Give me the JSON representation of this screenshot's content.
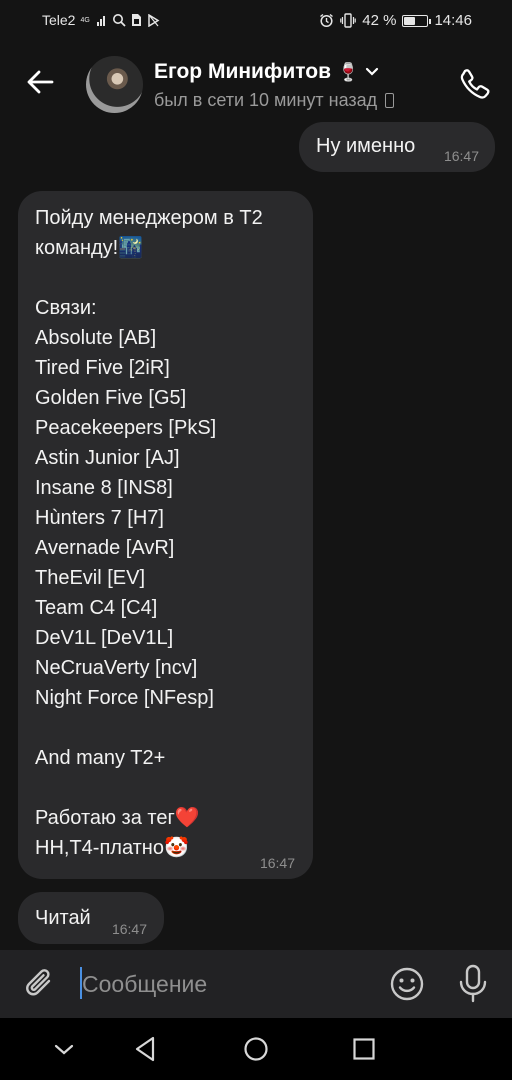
{
  "status_bar": {
    "carrier": "Tele2",
    "network": "4G",
    "battery_percent": "42 %",
    "battery_level": 0.42,
    "time": "14:46"
  },
  "header": {
    "contact_name": "Егор Минифитов",
    "name_emoji": "🍷",
    "last_seen": "был в сети 10 минут назад"
  },
  "messages": [
    {
      "direction": "outgoing",
      "text": "Ну именно",
      "time": "16:47"
    },
    {
      "direction": "incoming",
      "text": "Пойду менеджером в Т2 команду!🌃\n\nСвязи:\nAbsolute [AB]\nTired Five [2iR]\nGolden Five [G5]\nPeacekeepers [PkS]\nAstin Junior [AJ]\nInsane 8 [INS8]\nHùnters 7 [H7]\nAvernade [AvR]\nTheEvil [EV]\nTeam C4 [C4]\nDeV1L [DeV1L]\nNeCruaVerty [ncv]\nNight Force [NFesp]\n\nAnd many T2+\n\nРаботаю за тег❤️\nHH,T4-платно🤡",
      "time": "16:47"
    },
    {
      "direction": "incoming",
      "text": "Читай",
      "time": "16:47"
    }
  ],
  "composer": {
    "placeholder": "Сообщение"
  },
  "colors": {
    "background": "#141414",
    "bubble": "#2a2a2c",
    "composer": "#222224",
    "caret": "#4a90e2"
  }
}
